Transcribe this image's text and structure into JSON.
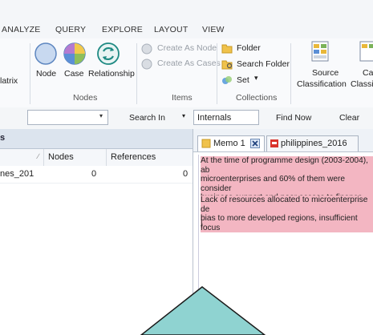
{
  "menu": {
    "tabs": [
      "ANALYZE",
      "QUERY",
      "EXPLORE",
      "LAYOUT",
      "VIEW"
    ]
  },
  "ribbon": {
    "matrix_label": "latrix",
    "node_label": "Node",
    "case_label": "Case",
    "relationship_label": "Relationship",
    "nodes_group": "Nodes",
    "create_as_node": "Create As Node",
    "create_as_cases": "Create As Cases",
    "items_group": "Items",
    "folder": "Folder",
    "search_folder": "Search Folder",
    "set": "Set",
    "collections_group": "Collections",
    "source_classification_1": "Source",
    "source_classification_2": "Classification",
    "case_classification_1": "Ca",
    "case_classification_2": "Classifi"
  },
  "searchbar": {
    "search_in": "Search In",
    "scope_value": "Internals",
    "find_now": "Find Now",
    "clear": "Clear"
  },
  "left_pane": {
    "title": "s",
    "columns": [
      "Nodes",
      "References"
    ],
    "rows": [
      {
        "name": "nes_201",
        "nodes": "0",
        "references": "0"
      }
    ]
  },
  "right_pane": {
    "tabs": [
      {
        "label": "Memo 1"
      },
      {
        "label": "philippines_2016"
      }
    ],
    "paragraph1": [
      "At the time of programme design (2003-2004), ab",
      "microenterprises and 60% of them were consider",
      "business support and poor access to finance"
    ],
    "paragraph2": [
      "Lack of resources allocated to microenterprise de",
      "bias to more developed regions, insufficient focus"
    ],
    "cursor": "|"
  },
  "colors": {
    "highlight": "#f3b6c2",
    "overlay": "#8fd3d1",
    "accent": "#2b6cc4"
  }
}
